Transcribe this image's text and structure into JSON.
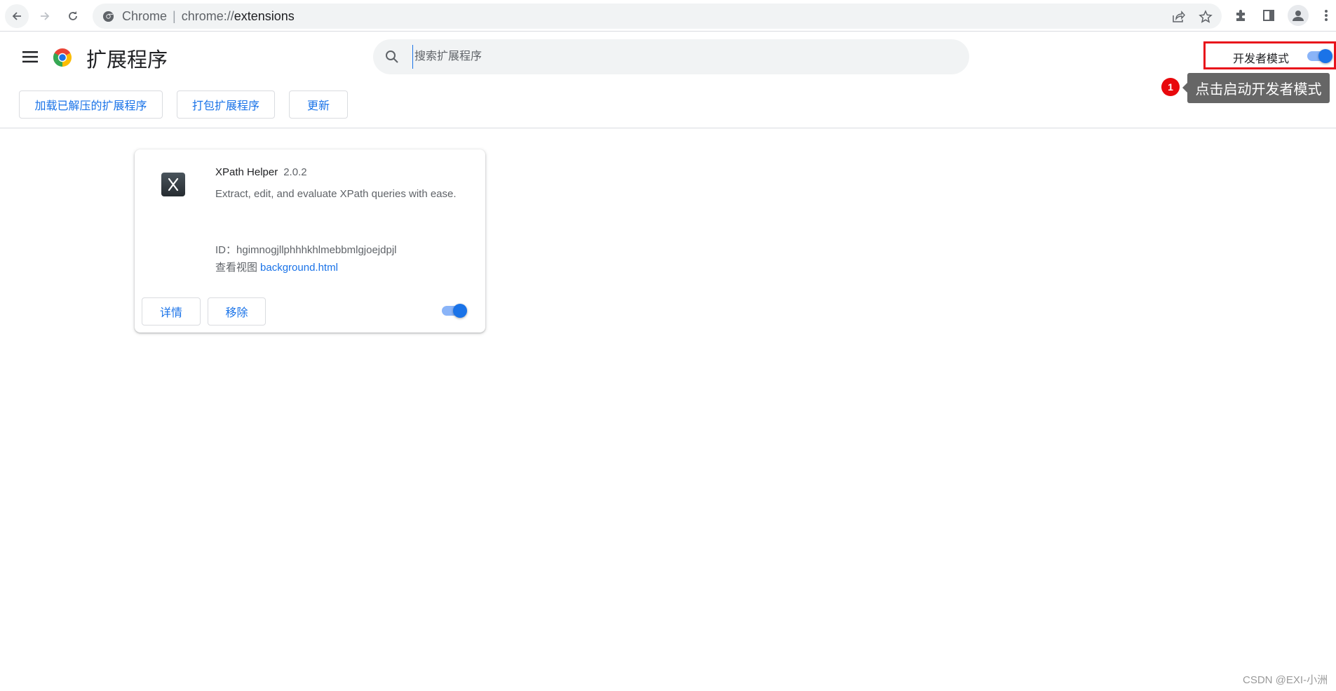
{
  "browser": {
    "omnibox": {
      "site_label": "Chrome",
      "separator": "|",
      "url_scheme": "chrome://",
      "url_host": "extensions"
    },
    "icons": {
      "back": "arrow-left-icon",
      "forward": "arrow-right-icon",
      "reload": "reload-icon",
      "site": "chrome-site-icon",
      "share": "share-icon",
      "bookmark": "star-icon",
      "extensions": "puzzle-icon",
      "side_panel": "side-panel-icon",
      "profile": "profile-icon",
      "menu": "kebab-menu-icon"
    }
  },
  "header": {
    "title": "扩展程序",
    "search": {
      "placeholder": "搜索扩展程序",
      "value": ""
    },
    "developer_mode": {
      "label": "开发者模式",
      "enabled": true
    },
    "buttons": {
      "load_unpacked": "加载已解压的扩展程序",
      "pack": "打包扩展程序",
      "update": "更新"
    }
  },
  "annotation": {
    "badge": "1",
    "text": "点击启动开发者模式",
    "badge_color": "#e8080c"
  },
  "extensions": [
    {
      "name": "XPath Helper",
      "version": "2.0.2",
      "description": "Extract, edit, and evaluate XPath queries with ease.",
      "id_label": "ID：",
      "id": "hgimnogjllphhhkhlmebbmlgjoejdpjl",
      "views_label": "查看视图",
      "view_link": "background.html",
      "details_button": "详情",
      "remove_button": "移除",
      "enabled": true
    }
  ],
  "watermark": "CSDN @EXI-小洲",
  "colors": {
    "accent": "#1a73e8",
    "toggle_track": "#8ab4f8",
    "highlight_box": "#e8121b",
    "tooltip_bg": "#666666"
  }
}
